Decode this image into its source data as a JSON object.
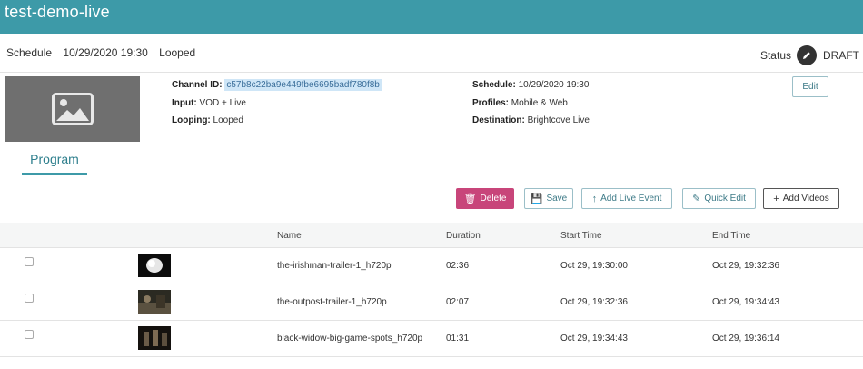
{
  "header": {
    "title": "test-demo-live"
  },
  "subheader": {
    "schedule_label": "Schedule",
    "schedule_value": "10/29/2020 19:30",
    "looping": "Looped",
    "status_label": "Status",
    "status_value": "DRAFT"
  },
  "details": {
    "channel_id_label": "Channel ID:",
    "channel_id_value": "c57b8c22ba9e449fbe6695badf780f8b",
    "input_label": "Input:",
    "input_value": "VOD + Live",
    "looping_label": "Looping:",
    "looping_value": "Looped",
    "schedule_label": "Schedule:",
    "schedule_value": "10/29/2020 19:30",
    "profiles_label": "Profiles:",
    "profiles_value": "Mobile & Web",
    "destination_label": "Destination:",
    "destination_value": "Brightcove Live",
    "edit_label": "Edit"
  },
  "tabs": {
    "program": "Program"
  },
  "toolbar": {
    "delete": "Delete",
    "save": "Save",
    "add_live_event": "Add Live Event",
    "quick_edit": "Quick Edit",
    "add_videos": "Add Videos"
  },
  "table": {
    "headers": {
      "name": "Name",
      "duration": "Duration",
      "start": "Start Time",
      "end": "End Time"
    },
    "rows": [
      {
        "name": "the-irishman-trailer-1_h720p",
        "duration": "02:36",
        "start": "Oct 29, 19:30:00",
        "end": "Oct 29, 19:32:36"
      },
      {
        "name": "the-outpost-trailer-1_h720p",
        "duration": "02:07",
        "start": "Oct 29, 19:32:36",
        "end": "Oct 29, 19:34:43"
      },
      {
        "name": "black-widow-big-game-spots_h720p",
        "duration": "01:31",
        "start": "Oct 29, 19:34:43",
        "end": "Oct 29, 19:36:14"
      }
    ]
  },
  "colors": {
    "brand": "#3d9aa8",
    "delete": "#c8457a",
    "highlight": "#cfe6f7"
  },
  "icons": {
    "status": "pencil-icon",
    "placeholder": "image-placeholder-icon",
    "delete": "trash-icon",
    "save": "floppy-icon",
    "live": "arrow-up-icon",
    "quick": "pencil-icon",
    "add": "plus-icon"
  }
}
